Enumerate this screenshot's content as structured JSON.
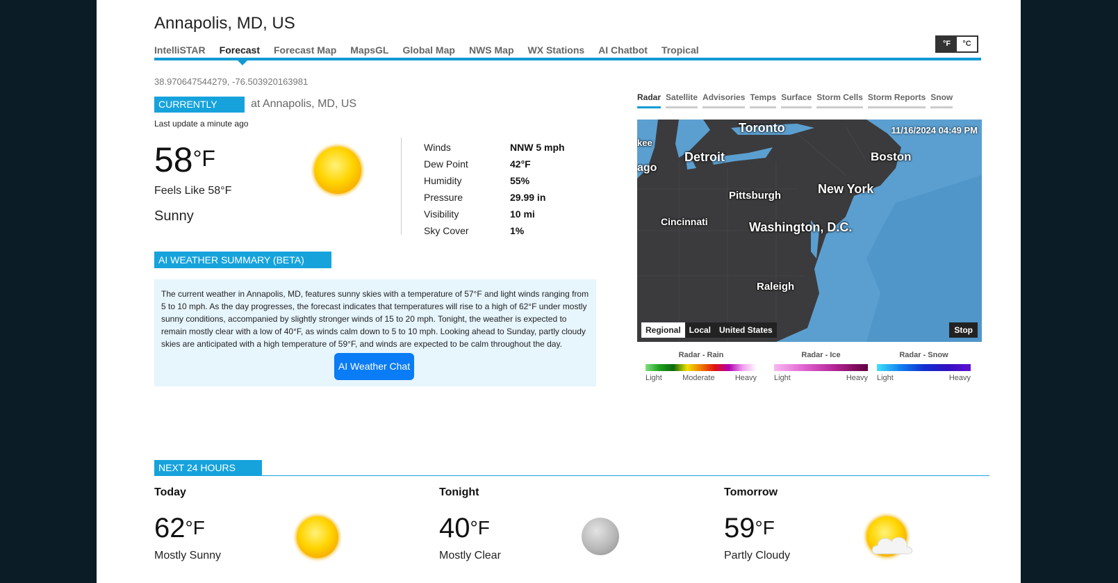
{
  "header": {
    "city": "Annapolis, MD, US",
    "unit_f": "°F",
    "unit_c": "°C",
    "tabs": [
      "IntelliSTAR",
      "Forecast",
      "Forecast Map",
      "MapsGL",
      "Global Map",
      "NWS Map",
      "WX Stations",
      "AI Chatbot",
      "Tropical"
    ],
    "active_tab": "Forecast",
    "coordinates": "38.970647544279, -76.503920163981"
  },
  "current": {
    "label": "CURRENTLY",
    "at_city": "at Annapolis, MD, US",
    "last_update": "Last update a minute ago",
    "temp": "58",
    "unit": "°F",
    "feels_like": "Feels Like 58°F",
    "condition": "Sunny",
    "icon": "sun-icon",
    "details": [
      {
        "key": "Winds",
        "value": "NNW 5 mph"
      },
      {
        "key": "Dew Point",
        "value": "42°F"
      },
      {
        "key": "Humidity",
        "value": "55%"
      },
      {
        "key": "Pressure",
        "value": "29.99 in"
      },
      {
        "key": "Visibility",
        "value": "10 mi"
      },
      {
        "key": "Sky Cover",
        "value": "1%"
      }
    ]
  },
  "ai_summary": {
    "label": "AI WEATHER SUMMARY (BETA)",
    "text": "The current weather in Annapolis, MD, features sunny skies with a temperature of 57°F and light winds ranging from 5 to 10 mph. As the day progresses, the forecast indicates that temperatures will rise to a high of 62°F under mostly sunny conditions, accompanied by slightly stronger winds of 15 to 20 mph. Tonight, the weather is expected to remain mostly clear with a low of 40°F, as winds calm down to 5 to 10 mph. Looking ahead to Sunday, partly cloudy skies are anticipated with a high temperature of 59°F, and winds are expected to be calm throughout the day.",
    "button": "AI Weather Chat"
  },
  "map": {
    "tabs": [
      "Radar",
      "Satellite",
      "Advisories",
      "Temps",
      "Surface",
      "Storm Cells",
      "Storm Reports",
      "Snow"
    ],
    "active_tab": "Radar",
    "timestamp": "11/16/2024 04:49 PM",
    "cities": [
      "Toronto",
      "Detroit",
      "kee",
      "ago",
      "Boston",
      "Pittsburgh",
      "New York",
      "Cincinnati",
      "Washington, D.C.",
      "Raleigh"
    ],
    "scope_buttons": [
      "Regional",
      "Local",
      "United States"
    ],
    "selected_scope": "Regional",
    "stop": "Stop",
    "ocean_color": "#5b9fd0",
    "land_color": "#3b3b3d"
  },
  "legends": [
    {
      "title": "Radar - Rain",
      "ticks": [
        "Light",
        "Moderate",
        "Heavy"
      ]
    },
    {
      "title": "Radar - Ice",
      "ticks": [
        "Light",
        "Heavy"
      ]
    },
    {
      "title": "Radar - Snow",
      "ticks": [
        "Light",
        "Heavy"
      ]
    }
  ],
  "next24": {
    "label": "NEXT 24 HOURS",
    "periods": [
      {
        "name": "Today",
        "temp": "62",
        "unit": "°F",
        "condition": "Mostly Sunny",
        "icon": "sun-icon"
      },
      {
        "name": "Tonight",
        "temp": "40",
        "unit": "°F",
        "condition": "Mostly Clear",
        "icon": "moon-icon"
      },
      {
        "name": "Tomorrow",
        "temp": "59",
        "unit": "°F",
        "condition": "Partly Cloudy",
        "icon": "partly-cloudy-icon"
      }
    ]
  },
  "colors": {
    "accent": "#16a3dc",
    "nav_line": "#0f9ad6",
    "button": "#0a7cf5",
    "ai_box_bg": "#e7f5fd",
    "outer_bg": "#0b1c26"
  }
}
